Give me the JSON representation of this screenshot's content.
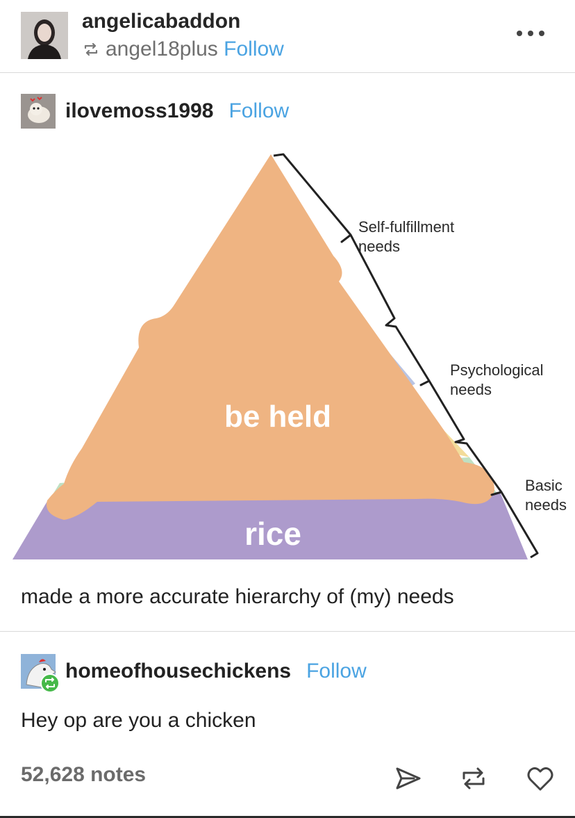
{
  "header": {
    "blog_name": "angelicabaddon",
    "reblogged_from": "angel18plus",
    "follow_label": "Follow",
    "more_icon": "more-icon"
  },
  "original_post": {
    "username": "ilovemoss1998",
    "follow_label": "Follow",
    "image": {
      "top_label": "be held",
      "bottom_label": "rice",
      "annotations": {
        "self_fulfillment_line1": "Self-fulfillment",
        "self_fulfillment_line2": "needs",
        "psychological_line1": "Psychological",
        "psychological_line2": "needs",
        "basic_line1": "Basic",
        "basic_line2": "needs"
      },
      "colors": {
        "peach": "#efb482",
        "purple": "#ad9bcc",
        "blue": "#b9c4e3",
        "yellow": "#f3dc9a",
        "green": "#bfe0c3"
      }
    },
    "caption": "made a more accurate hierarchy of (my) needs"
  },
  "reply": {
    "username": "homeofhousechickens",
    "follow_label": "Follow",
    "text": "Hey op are you a chicken"
  },
  "footer": {
    "notes": "52,628 notes",
    "actions": [
      "share-icon",
      "reblog-icon",
      "heart-icon"
    ]
  }
}
